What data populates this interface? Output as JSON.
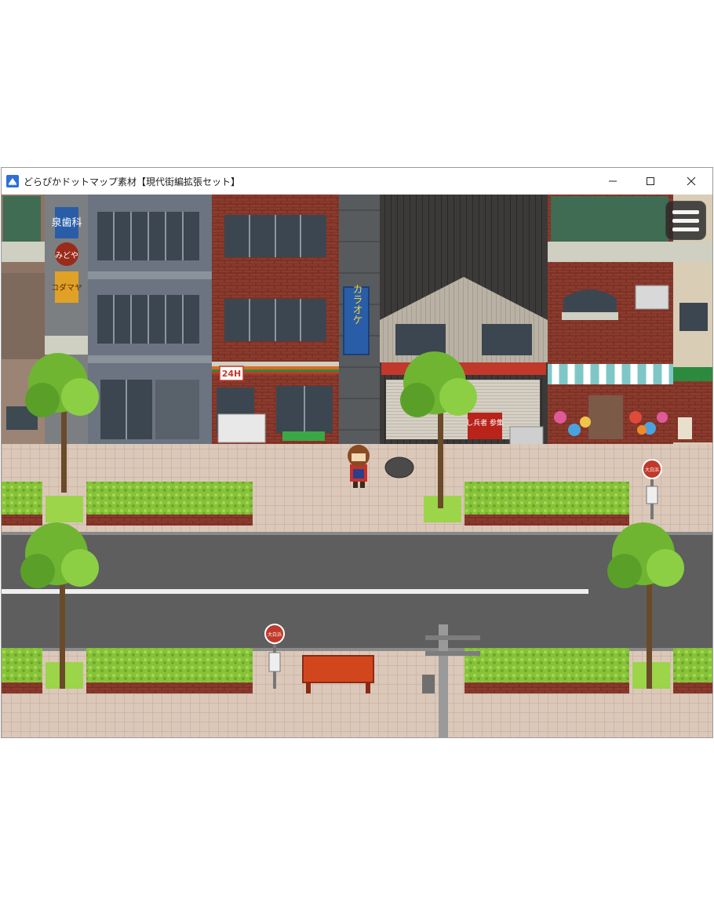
{
  "window": {
    "title": "どらぴかドットマップ素材【現代街編拡張セット】",
    "controls": {
      "minimize": "minimize-icon",
      "maximize": "maximize-icon",
      "close": "close-icon"
    }
  },
  "signs": {
    "dental_clinic": "泉歯科",
    "midoriya": "みどや",
    "kodamaya": "コダマヤ",
    "karaoke": "カラオケ",
    "convenience_store": "24H",
    "shop_sign": "し兵者 参集",
    "bus_stop": "大白浜"
  },
  "menu": {
    "icon": "hamburger-menu-icon"
  },
  "colors": {
    "sidewalk": "#d9c6b7",
    "road": "#5e5e5e",
    "shrub": "#8bc83a",
    "brick": "#8a3a2a",
    "accent_blue": "#2a5da8"
  }
}
